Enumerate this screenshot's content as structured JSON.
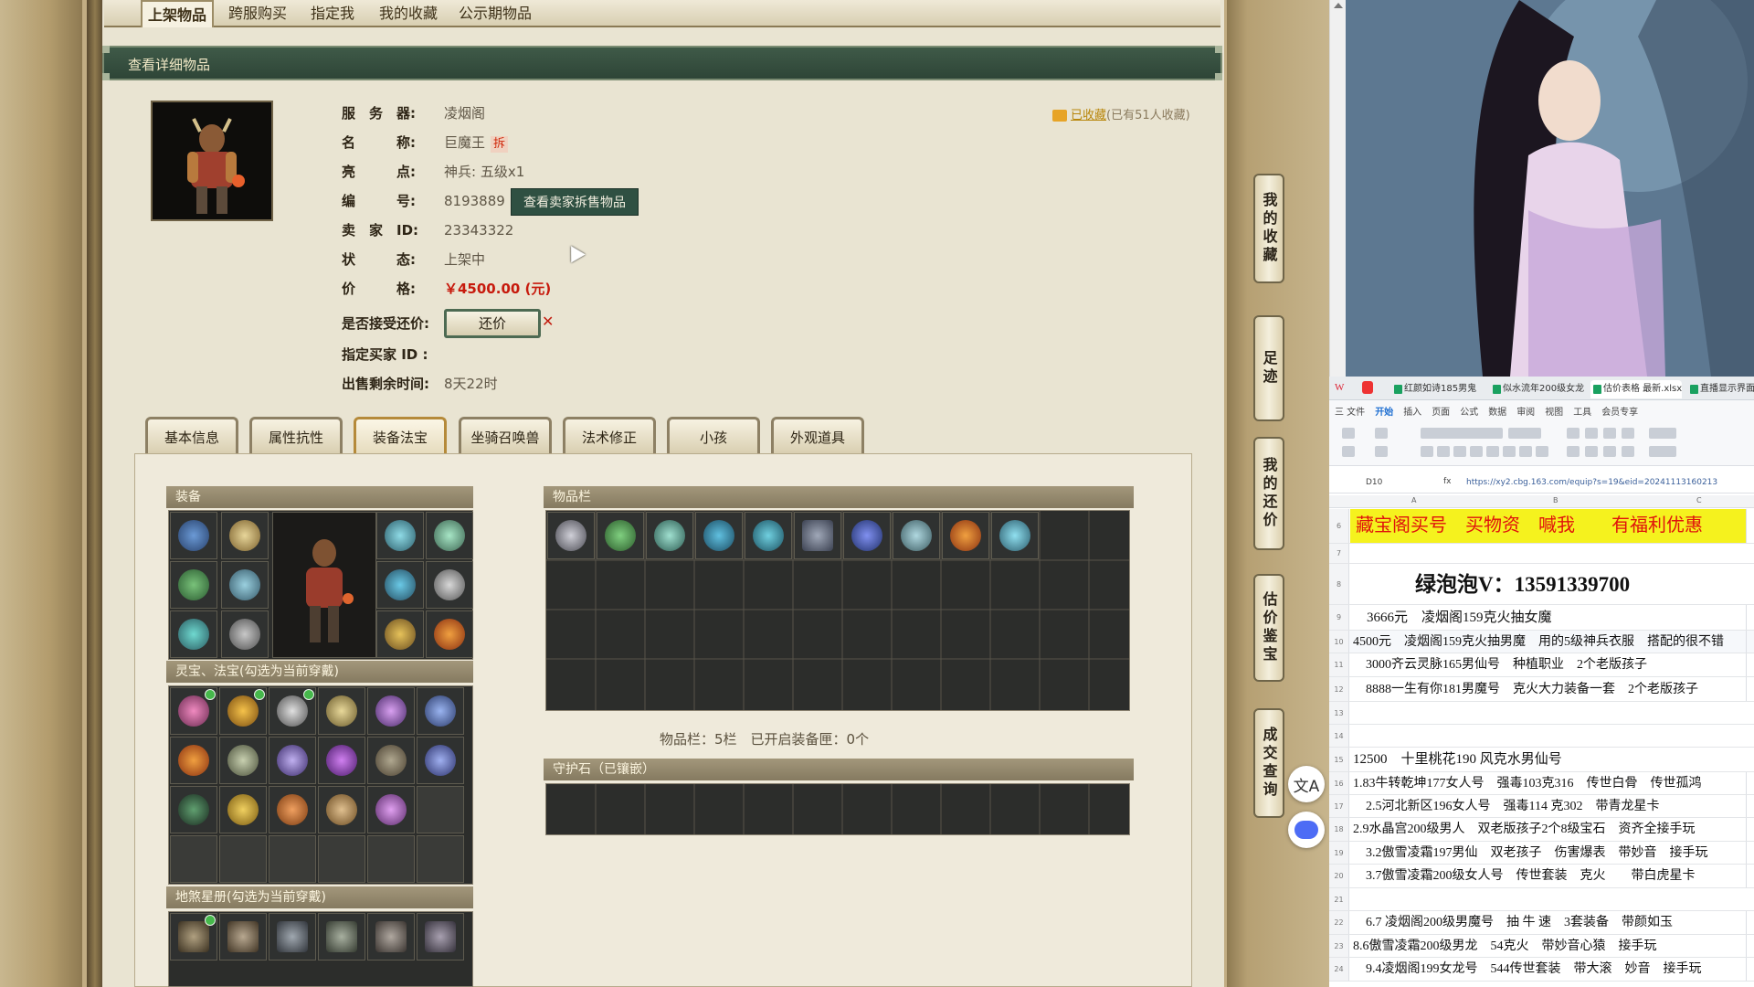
{
  "top_tabs": [
    "上架物品",
    "跨服购买",
    "指定我",
    "我的收藏",
    "公示期物品"
  ],
  "panel_title": "查看详细物品",
  "favorite": {
    "label": "已收藏",
    "count_text": "(已有51人收藏)"
  },
  "info": {
    "server_label": "服　务　器:",
    "server": "凌烟阁",
    "name_label": "名　　　称:",
    "name": "巨魔王",
    "name_badge": "拆",
    "highlight_label": "亮　　　点:",
    "highlight": "神兵: 五级x1",
    "id_label": "编　　　号:",
    "id": "8193889",
    "seller_items_button": "查看卖家拆售物品",
    "seller_label": "卖　家　ID:",
    "seller_id": "23343322",
    "status_label": "状　　　态:",
    "status": "上架中",
    "price_label": "价　　　格:",
    "price": "￥4500.00 (元)",
    "haggle_label": "是否接受还价:",
    "haggle_button": "还价",
    "buyer_label": "指定买家 ID :",
    "buyer_id": "",
    "remaining_label": "出售剩余时间:",
    "remaining": "8天22时"
  },
  "detail_tabs": [
    "基本信息",
    "属性抗性",
    "装备法宝",
    "坐骑召唤兽",
    "法术修正",
    "小孩",
    "外观道具"
  ],
  "sections": {
    "equipment": "装备",
    "treasures": "灵宝、法宝(勾选为当前穿戴)",
    "star_book": "地煞星册(勾选为当前穿戴)",
    "inventory": "物品栏",
    "inventory_status": "物品栏：5栏　已开启装备匣：0个",
    "guard_stone": "守护石（已镶嵌）"
  },
  "side_buttons": [
    "我的收藏",
    "足迹",
    "我的还价",
    "估价鉴宝",
    "成交查询"
  ],
  "fab_icons": [
    "translate-icon",
    "chat-bot-icon"
  ],
  "sheet": {
    "tabs": [
      "红颜如诗185男鬼",
      "似水流年200级女龙",
      "估价表格 最新.xlsx",
      "直播显示界面"
    ],
    "menu": [
      "三 文件",
      "开始",
      "插入",
      "页面",
      "公式",
      "数据",
      "审阅",
      "视图",
      "工具",
      "会员专享"
    ],
    "cell_ref": "D10",
    "formula": "https://xy2.cbg.163.com/equip?s=19&eid=20241113160213",
    "col_letters": [
      "A",
      "B",
      "C"
    ],
    "rows": [
      {
        "n": "6",
        "text": "藏宝阁买号　买物资　喊我　　有福利优惠",
        "style": "banner"
      },
      {
        "n": "7",
        "text": ""
      },
      {
        "n": "8",
        "text": "绿泡泡V：13591339700",
        "style": "big"
      },
      {
        "n": "9",
        "text": "　3666元　凌烟阁159克火抽女魔"
      },
      {
        "n": "10",
        "text": "4500元　凌烟阁159克火抽男魔　用的5级神兵衣服　搭配的很不错"
      },
      {
        "n": "11",
        "text": "　3000齐云灵脉165男仙号　种植职业　2个老版孩子"
      },
      {
        "n": "12",
        "text": "　8888一生有你181男魔号　克火大力装备一套　2个老版孩子"
      },
      {
        "n": "13",
        "text": ""
      },
      {
        "n": "14",
        "text": ""
      },
      {
        "n": "15",
        "text": "12500　十里桃花190  风克水男仙号"
      },
      {
        "n": "16",
        "text": "1.83牛转乾坤177女人号　强毒103克316　传世白骨　传世孤鸿"
      },
      {
        "n": "17",
        "text": "　2.5河北新区196女人号　强毒114  克302　带青龙星卡"
      },
      {
        "n": "18",
        "text": "2.9水晶宫200级男人　双老版孩子2个8级宝石　资齐全接手玩"
      },
      {
        "n": "19",
        "text": "　3.2傲雪凌霜197男仙　双老孩子　伤害爆表　带妙音　接手玩"
      },
      {
        "n": "20",
        "text": "　3.7傲雪凌霜200级女人号　传世套装　克火　　带白虎星卡"
      },
      {
        "n": "21",
        "text": ""
      },
      {
        "n": "22",
        "text": "　6.7 凌烟阁200级男魔号　抽 牛 速　3套装备　带颜如玉"
      },
      {
        "n": "23",
        "text": "8.6傲雪凌霜200级男龙　54克火　带妙音心猿　接手玩"
      },
      {
        "n": "24",
        "text": "　9.4凌烟阁199女龙号　544传世套装　带大滚　妙音　接手玩"
      }
    ]
  },
  "colors": {
    "accent_green": "#2f5042",
    "price_red": "#c71a0d",
    "banner_yellow": "#f5f21e",
    "banner_red": "#e0120c"
  }
}
